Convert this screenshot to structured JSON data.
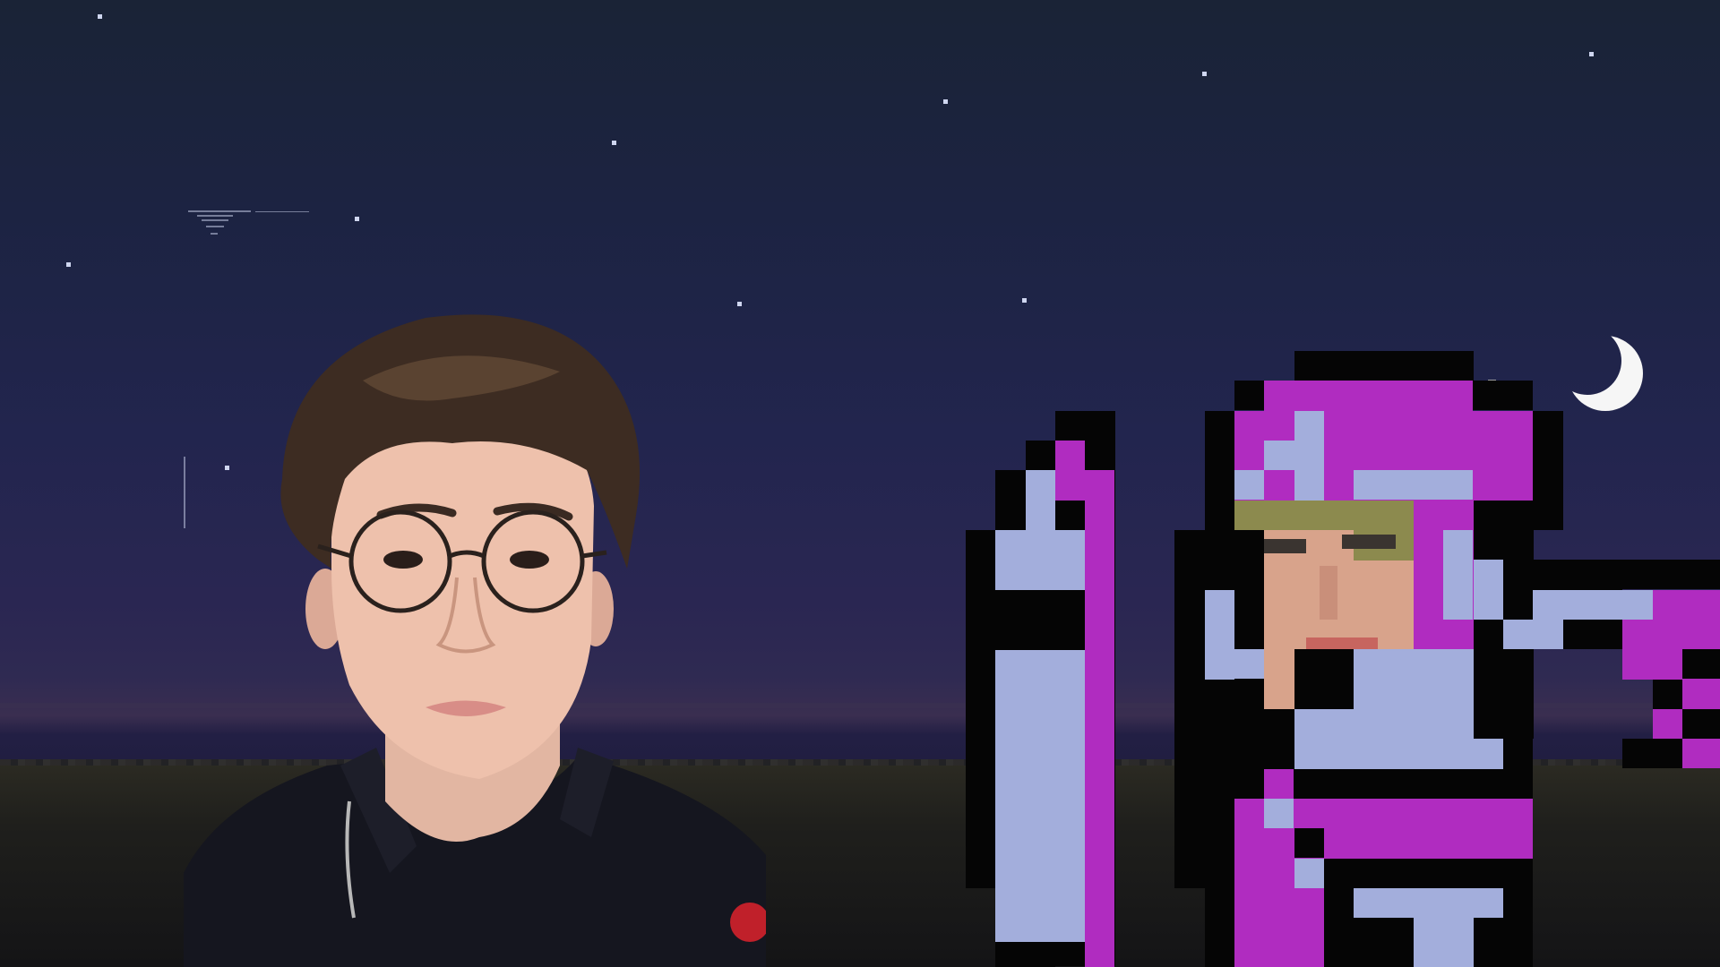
{
  "scene": {
    "description_colors": {
      "sky_top": "#1a2336",
      "sky_mid": "#22254e",
      "horizon": "#3a2e50",
      "ground": "#1f1f1c",
      "moon": "#f4f4f4",
      "armor_magenta": "#b02cc0",
      "armor_lavender": "#a3aedc",
      "outline": "#050505"
    },
    "icons": [
      "crescent-moon-icon",
      "star-icon"
    ]
  }
}
